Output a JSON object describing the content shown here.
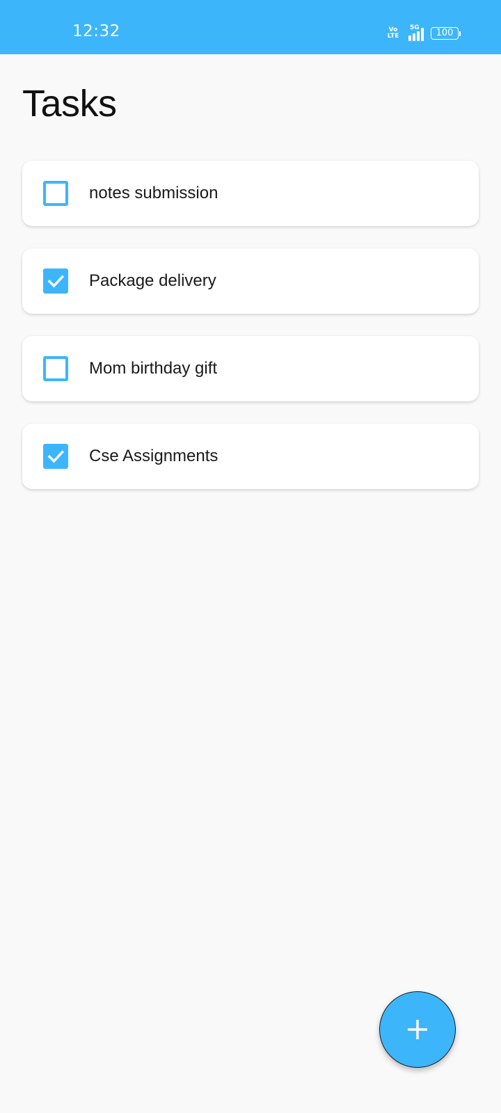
{
  "status_bar": {
    "time": "12:32",
    "volte_top": "Vo",
    "volte_bottom": "LTE",
    "network": "5G",
    "battery": "100",
    "background_color": "#3db5fb"
  },
  "page": {
    "title": "Tasks"
  },
  "tasks": [
    {
      "label": "notes submission",
      "checked": false
    },
    {
      "label": "Package delivery",
      "checked": true
    },
    {
      "label": "Mom birthday gift",
      "checked": false
    },
    {
      "label": "Cse Assignments",
      "checked": true
    }
  ],
  "fab": {
    "icon": "plus-icon",
    "color": "#3db5fb"
  },
  "colors": {
    "accent": "#3db5fb",
    "background": "#f9f9f9",
    "card": "#ffffff"
  }
}
